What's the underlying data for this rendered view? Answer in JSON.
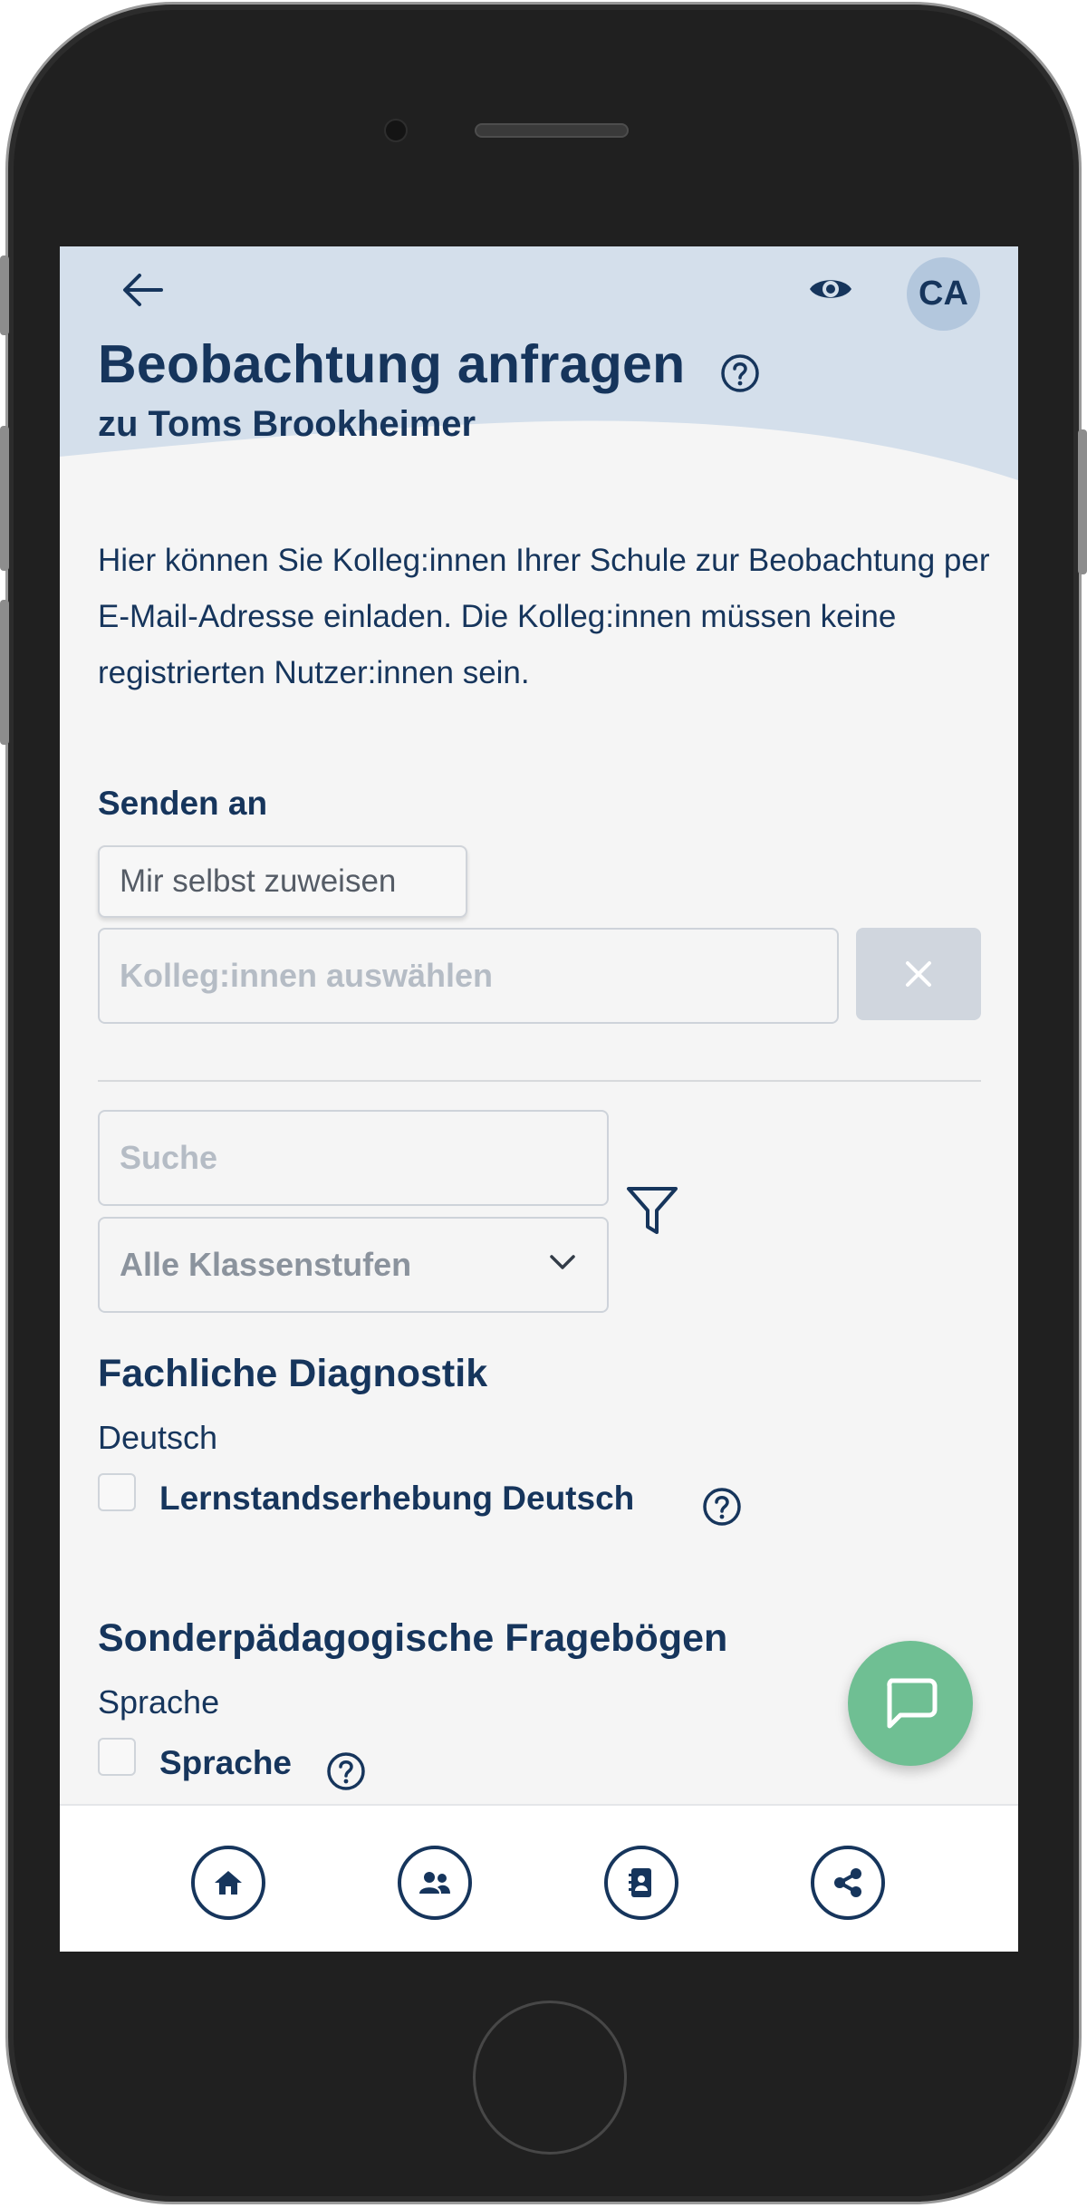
{
  "header": {
    "title": "Beobachtung anfragen",
    "subtitle": "zu Toms Brookheimer",
    "avatar_initials": "CA",
    "icons": [
      "back-arrow-icon",
      "eye-icon",
      "help-icon"
    ]
  },
  "intro_text": "Hier können Sie Kolleg:innen Ihrer Schule zur Beobachtung per E-Mail-Adresse einladen. Die Kolleg:innen müssen keine registrierten Nutzer:innen sein.",
  "send_to": {
    "label": "Senden an",
    "assign_self_label": "Mir selbst zuweisen",
    "colleagues_placeholder": "Kolleg:innen auswählen"
  },
  "filters": {
    "search_placeholder": "Suche",
    "grade_selected": "Alle Klassenstufen"
  },
  "sections": [
    {
      "title": "Fachliche Diagnostik",
      "subsection": "Deutsch",
      "items": [
        {
          "label": "Lernstandserhebung Deutsch",
          "checked": false
        }
      ]
    },
    {
      "title": "Sonderpädagogische Fragebögen",
      "subsection": "Sprache",
      "items": [
        {
          "label": "Sprache",
          "checked": false
        }
      ]
    }
  ],
  "bottom_nav": [
    "home-icon",
    "users-icon",
    "address-book-icon",
    "share-icon"
  ],
  "colors": {
    "primary": "#16355c",
    "header_bg": "#d4dfeb",
    "avatar_bg": "#b3c7dd",
    "fab": "#6fbf93",
    "page_bg": "#f5f5f5"
  }
}
